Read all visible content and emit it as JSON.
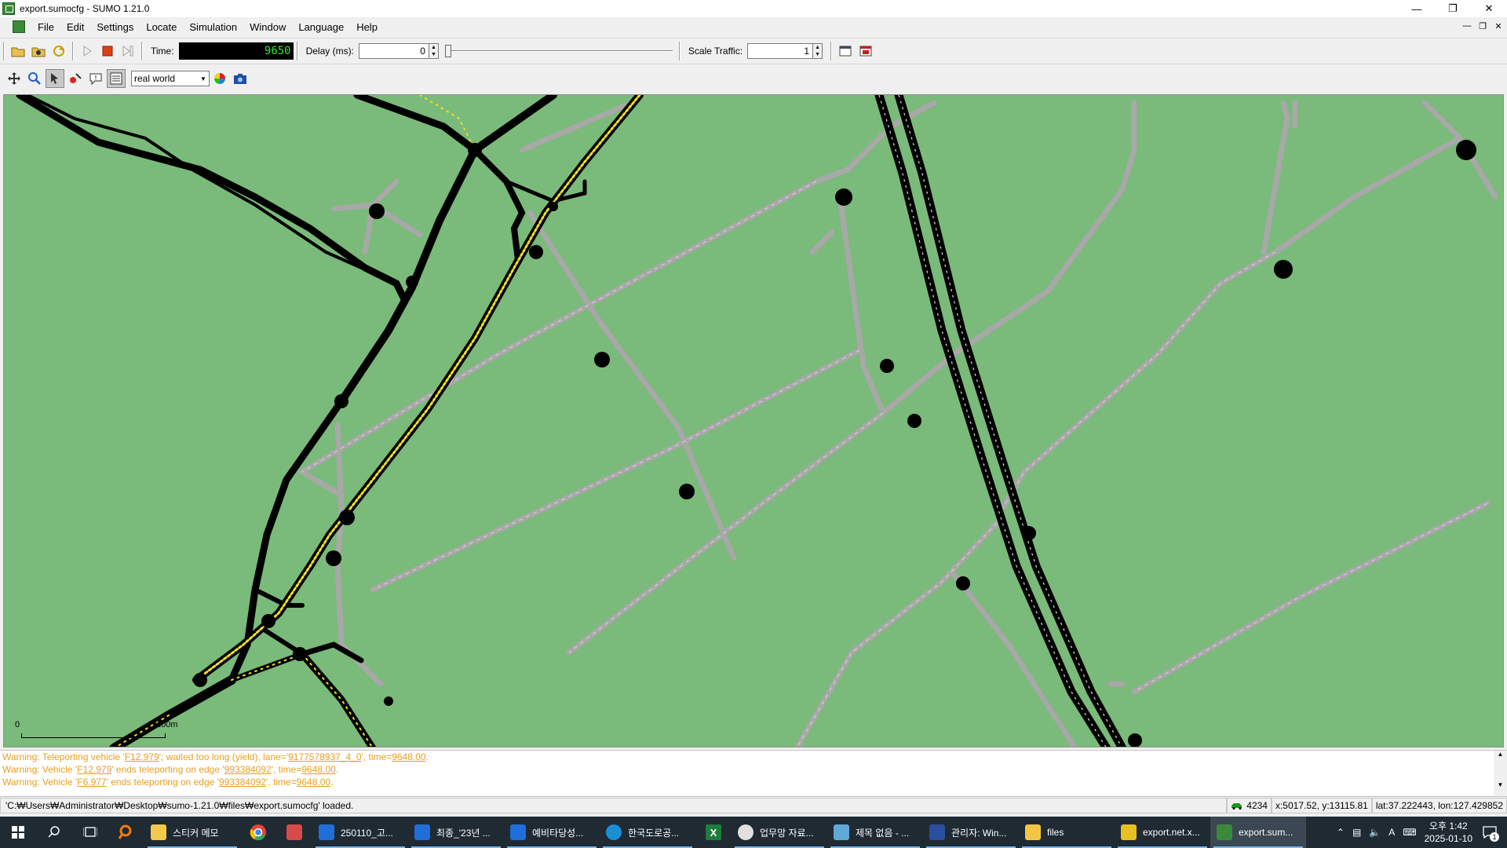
{
  "window": {
    "title": "export.sumocfg - SUMO 1.21.0"
  },
  "menu": [
    "File",
    "Edit",
    "Settings",
    "Locate",
    "Simulation",
    "Window",
    "Language",
    "Help"
  ],
  "toolbar": {
    "time_label": "Time:",
    "time_value": "9650",
    "delay_label": "Delay (ms):",
    "delay_value": "0",
    "scale_traffic_label": "Scale Traffic:",
    "scale_traffic_value": "1"
  },
  "view": {
    "scheme": "real world",
    "scale_start": "0",
    "scale_end": "100m"
  },
  "messages": [
    {
      "a": "Warning: Teleporting vehicle '",
      "l1": "F12.979",
      "b": "'; waited too long (yield), lane='",
      "l2": "9177578937_4_0",
      "c": "', time=",
      "l3": "9648.00",
      "d": "."
    },
    {
      "a": "Warning: Vehicle '",
      "l1": "F12.979",
      "b": "' ends teleporting on edge '",
      "l2": "993384092",
      "c": "', time=",
      "l3": "9648.00",
      "d": "."
    },
    {
      "a": "Warning: Vehicle '",
      "l1": "F6.977",
      "b": "' ends teleporting on edge '",
      "l2": "993384092",
      "c": "', time=",
      "l3": "9648.00",
      "d": "."
    }
  ],
  "status": {
    "text": "'C:₩Users₩Administrator₩Desktop₩sumo-1.21.0₩files₩export.sumocfg' loaded.",
    "vehicles": "4234",
    "xy": "x:5017.52, y:13115.81",
    "latlon": "lat:37.222443, lon:127.429852"
  },
  "taskbar": {
    "apps": [
      {
        "label": "스티커 메모",
        "color": "#f2c94c"
      },
      {
        "label": "",
        "color": "#e94235"
      },
      {
        "label": "",
        "color": "#d64a4a"
      },
      {
        "label": "250110_고...",
        "color": "#1e6fd9"
      },
      {
        "label": "최종_'23년 ...",
        "color": "#1e6fd9"
      },
      {
        "label": "예비타당성...",
        "color": "#1e6fd9"
      },
      {
        "label": "한국도로공...",
        "color": "#1a8fd6"
      },
      {
        "label": "",
        "color": "#1e7d3a"
      },
      {
        "label": "업무망 자료...",
        "color": "#e0e0e0"
      },
      {
        "label": "제목 없음 - ...",
        "color": "#5fa8d8"
      },
      {
        "label": "관리자: Win...",
        "color": "#2a4f9e"
      },
      {
        "label": "files",
        "color": "#f4c542"
      },
      {
        "label": "export.net.x...",
        "color": "#e8c020"
      },
      {
        "label": "export.sum...",
        "color": "#3a8a3a"
      }
    ],
    "clock_time": "오후 1:42",
    "clock_date": "2025-01-10",
    "ime": "A",
    "notif": "1"
  }
}
